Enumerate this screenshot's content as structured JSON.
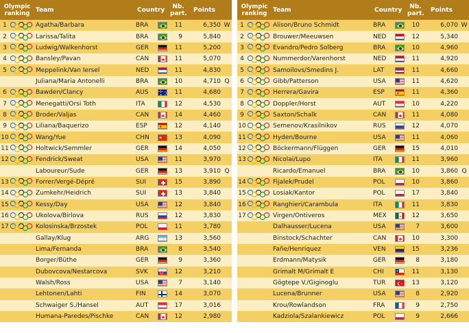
{
  "headers": {
    "rank_line1": "Olympic",
    "rank_line2": "ranking",
    "team": "Team",
    "country": "Country",
    "np_line1": "Nb.",
    "np_line2": "part.",
    "points": "Points"
  },
  "left": [
    {
      "rank": "1",
      "rings": true,
      "team": "Agatha/Barbara",
      "country": "BRA",
      "np": "11",
      "points": "6,350",
      "q": "W"
    },
    {
      "rank": "2",
      "rings": true,
      "team": "Larissa/Talita",
      "country": "BRA",
      "np": "9",
      "points": "5,840",
      "q": ""
    },
    {
      "rank": "3",
      "rings": true,
      "team": "Ludwig/Walkenhorst",
      "country": "GER",
      "np": "11",
      "points": "5,200",
      "q": ""
    },
    {
      "rank": "4",
      "rings": true,
      "team": "Bansley/Pavan",
      "country": "CAN",
      "np": "11",
      "points": "5,070",
      "q": ""
    },
    {
      "rank": "5",
      "rings": true,
      "team": "Meppelink/Van Iersel",
      "country": "NED",
      "np": "11",
      "points": "4,830",
      "q": ""
    },
    {
      "rank": "",
      "rings": false,
      "team": "Juliana/Maria Antonelli",
      "country": "BRA",
      "np": "10",
      "points": "4,710",
      "q": "Q"
    },
    {
      "rank": "6",
      "rings": true,
      "team": "Bawden/Clancy",
      "country": "AUS",
      "np": "11",
      "points": "4,680",
      "q": ""
    },
    {
      "rank": "7",
      "rings": true,
      "team": "Menegatti/Orsi Toth",
      "country": "ITA",
      "np": "12",
      "points": "4,530",
      "q": ""
    },
    {
      "rank": "8",
      "rings": true,
      "team": "Broder/Valjas",
      "country": "CAN",
      "np": "14",
      "points": "4,460",
      "q": ""
    },
    {
      "rank": "9",
      "rings": true,
      "team": "Liliana/Baquerizo",
      "country": "ESP",
      "np": "12",
      "points": "4,140",
      "q": ""
    },
    {
      "rank": "10",
      "rings": true,
      "team": "Wang/Yue",
      "country": "CHN",
      "np": "13",
      "points": "4,090",
      "q": ""
    },
    {
      "rank": "11",
      "rings": true,
      "team": "Holtwick/Semmler",
      "country": "GER",
      "np": "14",
      "points": "4,050",
      "q": ""
    },
    {
      "rank": "12",
      "rings": true,
      "team": "Fendrick/Sweat",
      "country": "USA",
      "np": "11",
      "points": "3,970",
      "q": ""
    },
    {
      "rank": "",
      "rings": false,
      "team": "Laboureur/Sude",
      "country": "GER",
      "np": "13",
      "points": "3,910",
      "q": "Q"
    },
    {
      "rank": "13",
      "rings": true,
      "team": "Forrer/Vergé-Dépré",
      "country": "SUI",
      "np": "15",
      "points": "3,890",
      "q": ""
    },
    {
      "rank": "14",
      "rings": true,
      "team": "Zumkehr/Heidrich",
      "country": "SUI",
      "np": "13",
      "points": "3,840",
      "q": ""
    },
    {
      "rank": "15",
      "rings": true,
      "team": "Kessy/Day",
      "country": "USA",
      "np": "12",
      "points": "3,840",
      "q": ""
    },
    {
      "rank": "16",
      "rings": true,
      "team": "Ukolova/Birlova",
      "country": "RUS",
      "np": "12",
      "points": "3,830",
      "q": ""
    },
    {
      "rank": "17",
      "rings": true,
      "team": "Kolosinska/Brzostek",
      "country": "POL",
      "np": "11",
      "points": "3,780",
      "q": ""
    },
    {
      "rank": "",
      "rings": false,
      "team": "Gallay/Klug",
      "country": "ARG",
      "np": "13",
      "points": "3,560",
      "q": ""
    },
    {
      "rank": "",
      "rings": false,
      "team": "Lima/Fernanda",
      "country": "BRA",
      "np": "8",
      "points": "3,540",
      "q": ""
    },
    {
      "rank": "",
      "rings": false,
      "team": "Borger/Büthe",
      "country": "GER",
      "np": "9",
      "points": "3,360",
      "q": ""
    },
    {
      "rank": "",
      "rings": false,
      "team": "Dubovcova/Nestarcova",
      "country": "SVK",
      "np": "12",
      "points": "3,210",
      "q": ""
    },
    {
      "rank": "",
      "rings": false,
      "team": "Walsh/Ross",
      "country": "USA",
      "np": "7",
      "points": "3,140",
      "q": ""
    },
    {
      "rank": "",
      "rings": false,
      "team": "Lehtonen/Lahti",
      "country": "FIN",
      "np": "14",
      "points": "3,070",
      "q": ""
    },
    {
      "rank": "",
      "rings": false,
      "team": "Schwaiger S./Hansel",
      "country": "AUT",
      "np": "17",
      "points": "3,016",
      "q": ""
    },
    {
      "rank": "",
      "rings": false,
      "team": "Humana-Paredes/Pischke",
      "country": "CAN",
      "np": "12",
      "points": "2,980",
      "q": ""
    }
  ],
  "right": [
    {
      "rank": "1",
      "rings": true,
      "team": "Alison/Bruno Schmidt",
      "country": "BRA",
      "np": "10",
      "points": "6,070",
      "q": "W"
    },
    {
      "rank": "2",
      "rings": true,
      "team": "Brouwer/Meeuwsen",
      "country": "NED",
      "np": "12",
      "points": "5,340",
      "q": ""
    },
    {
      "rank": "3",
      "rings": true,
      "team": "Evandro/Pedro Solberg",
      "country": "BRA",
      "np": "10",
      "points": "4,960",
      "q": ""
    },
    {
      "rank": "4",
      "rings": true,
      "team": "Nummerdor/Varenhorst",
      "country": "NED",
      "np": "11",
      "points": "4,920",
      "q": ""
    },
    {
      "rank": "5",
      "rings": true,
      "team": "Samoilovs/Smedins J.",
      "country": "LAT",
      "np": "11",
      "points": "4,660",
      "q": ""
    },
    {
      "rank": "6",
      "rings": true,
      "team": "Gibb/Patterson",
      "country": "USA",
      "np": "11",
      "points": "4,620",
      "q": ""
    },
    {
      "rank": "7",
      "rings": true,
      "team": "Herrera/Gavira",
      "country": "ESP",
      "np": "11",
      "points": "4,360",
      "q": ""
    },
    {
      "rank": "8",
      "rings": true,
      "team": "Doppler/Horst",
      "country": "AUT",
      "np": "10",
      "points": "4,220",
      "q": ""
    },
    {
      "rank": "9",
      "rings": true,
      "team": "Saxton/Schalk",
      "country": "CAN",
      "np": "11",
      "points": "4,080",
      "q": ""
    },
    {
      "rank": "10",
      "rings": true,
      "team": "Semenov/Krasilnikov",
      "country": "RUS",
      "np": "12",
      "points": "4,070",
      "q": ""
    },
    {
      "rank": "11",
      "rings": true,
      "team": "Hyden/Bourne",
      "country": "USA",
      "np": "11",
      "points": "4,060",
      "q": ""
    },
    {
      "rank": "12",
      "rings": true,
      "team": "Böckermann/Flüggen",
      "country": "GER",
      "np": "15",
      "points": "4,010",
      "q": ""
    },
    {
      "rank": "13",
      "rings": true,
      "team": "Nicolai/Lupo",
      "country": "ITA",
      "np": "11",
      "points": "3,960",
      "q": ""
    },
    {
      "rank": "",
      "rings": false,
      "team": "Ricardo/Emanuel",
      "country": "BRA",
      "np": "10",
      "points": "3,860",
      "q": "Q"
    },
    {
      "rank": "14",
      "rings": true,
      "team": "Fijalek/Prudel",
      "country": "POL",
      "np": "10",
      "points": "3,860",
      "q": ""
    },
    {
      "rank": "15",
      "rings": true,
      "team": "Losiak/Kantor",
      "country": "POL",
      "np": "17",
      "points": "3,840",
      "q": ""
    },
    {
      "rank": "16",
      "rings": true,
      "team": "Ranghieri/Carambula",
      "country": "ITA",
      "np": "11",
      "points": "3,830",
      "q": ""
    },
    {
      "rank": "17",
      "rings": true,
      "team": "Virgen/Ontiveros",
      "country": "MEX",
      "np": "12",
      "points": "3,650",
      "q": ""
    },
    {
      "rank": "",
      "rings": false,
      "team": "Dalhausser/Lucena",
      "country": "USA",
      "np": "7",
      "points": "3,600",
      "q": ""
    },
    {
      "rank": "",
      "rings": false,
      "team": "Binstock/Schachter",
      "country": "CAN",
      "np": "10",
      "points": "3,300",
      "q": ""
    },
    {
      "rank": "",
      "rings": false,
      "team": "Fañe/Henriquez",
      "country": "VEN",
      "np": "15",
      "points": "3,236",
      "q": ""
    },
    {
      "rank": "",
      "rings": false,
      "team": "Erdmann/Matysik",
      "country": "GER",
      "np": "8",
      "points": "3,180",
      "q": ""
    },
    {
      "rank": "",
      "rings": false,
      "team": "Grimalt M/Grimalt E",
      "country": "CHI",
      "np": "11",
      "points": "3,130",
      "q": ""
    },
    {
      "rank": "",
      "rings": false,
      "team": "Gögtepe V./Giginoglu",
      "country": "TUR",
      "np": "13",
      "points": "3,120",
      "q": ""
    },
    {
      "rank": "",
      "rings": false,
      "team": "Lucena/Brunner",
      "country": "USA",
      "np": "8",
      "points": "2,920",
      "q": ""
    },
    {
      "rank": "",
      "rings": false,
      "team": "Krou/Rowlandson",
      "country": "FRA",
      "np": "9",
      "points": "2,750",
      "q": ""
    },
    {
      "rank": "",
      "rings": false,
      "team": "Kadziola/Szalankiewicz",
      "country": "POL",
      "np": "9",
      "points": "2,666",
      "q": ""
    }
  ],
  "colors": {
    "header_bg": "#b07d1a",
    "row_odd": "#f4cf63",
    "row_even": "#fbeec2"
  }
}
